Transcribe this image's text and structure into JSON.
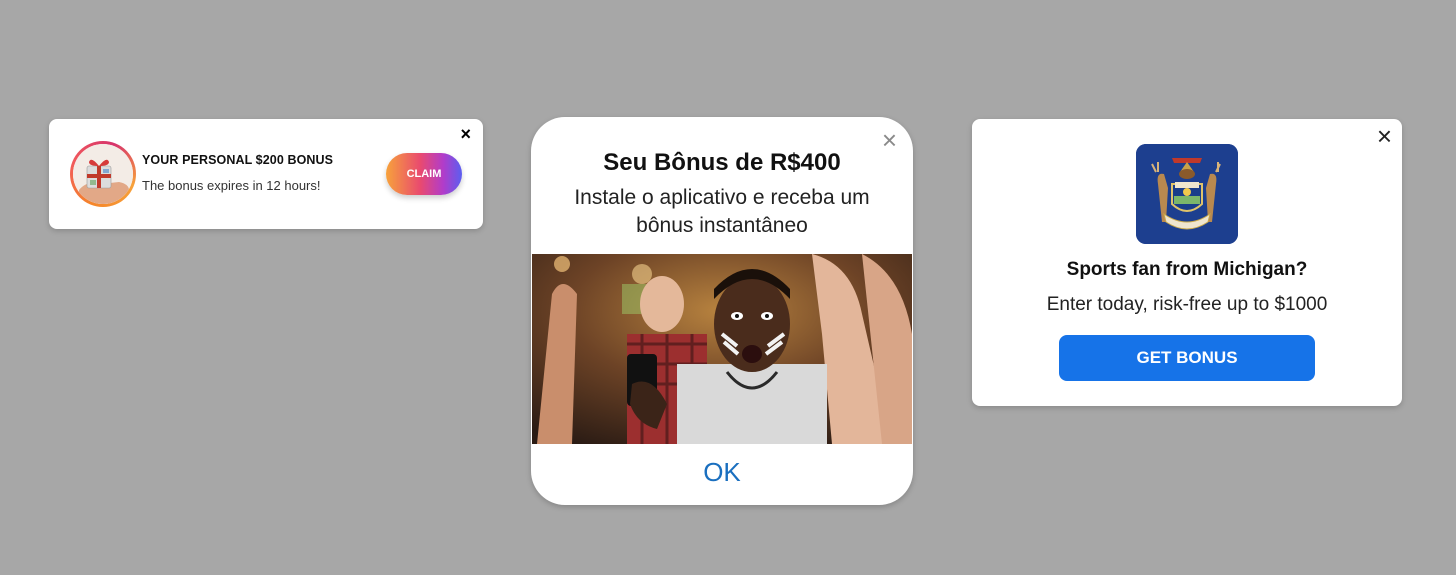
{
  "card1": {
    "title": "YOUR PERSONAL $200 BONUS",
    "subtitle": "The bonus expires in 12 hours!",
    "claim_label": "CLAIM",
    "close_icon": "×"
  },
  "card2": {
    "title": "Seu Bônus de R$400",
    "subtitle": "Instale o aplicativo e receba um bônus instantâneo",
    "ok_label": "OK",
    "close_icon": "×"
  },
  "card3": {
    "title": "Sports fan from Michigan?",
    "subtitle": "Enter today, risk-free up to $1000",
    "button_label": "GET BONUS",
    "close_icon": "×"
  },
  "colors": {
    "background": "#a7a7a7",
    "get_bonus_blue": "#1673e8",
    "ok_blue": "#1a6fbf",
    "seal_navy": "#1d3f8f"
  }
}
